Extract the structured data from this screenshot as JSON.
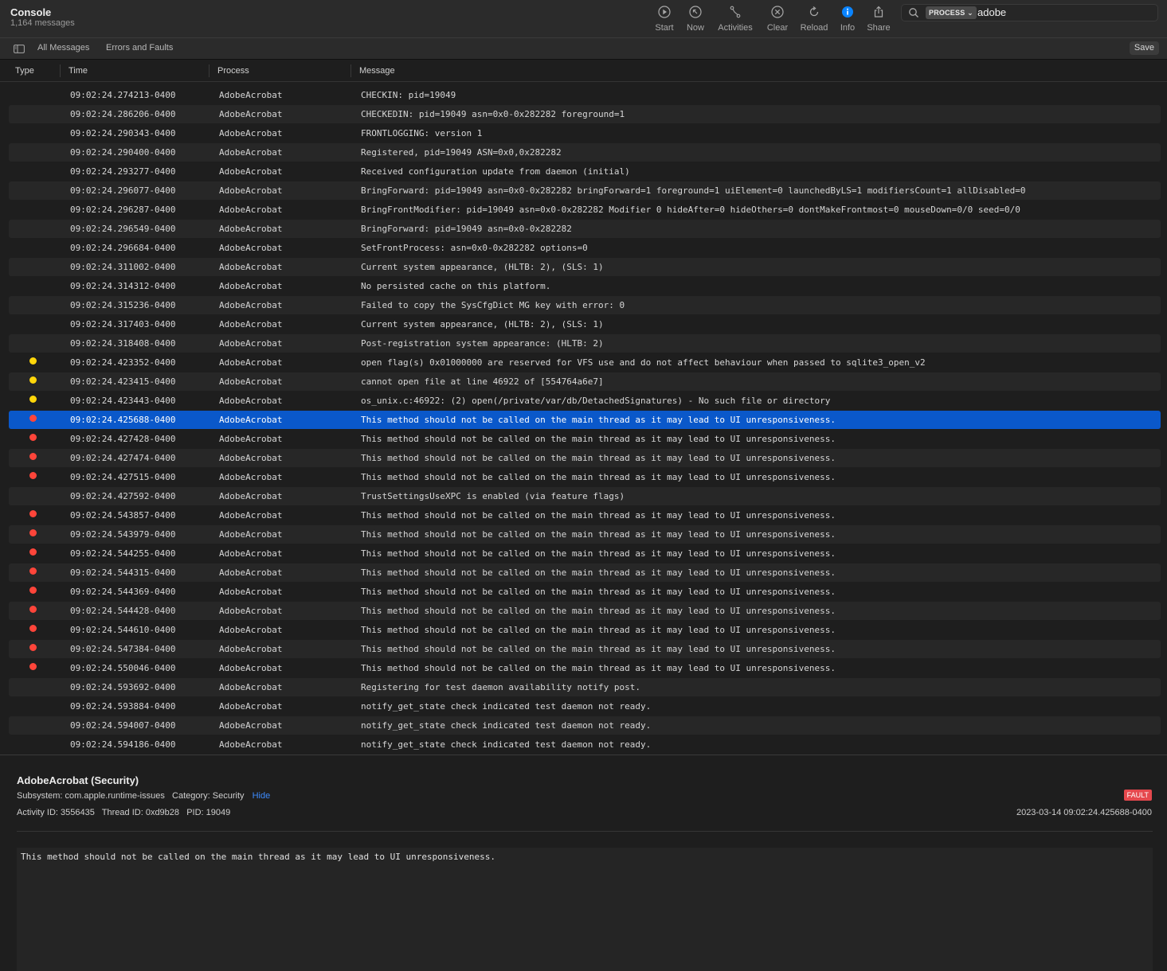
{
  "window": {
    "title": "Console",
    "subtitle": "1,164 messages"
  },
  "toolbar": {
    "start": "Start",
    "now": "Now",
    "activities": "Activities",
    "clear": "Clear",
    "reload": "Reload",
    "info": "Info",
    "share": "Share"
  },
  "search": {
    "token": "PROCESS",
    "query": "adobe"
  },
  "filters": {
    "all": "All Messages",
    "errors": "Errors and Faults",
    "save": "Save"
  },
  "columns": {
    "type": "Type",
    "time": "Time",
    "process": "Process",
    "message": "Message"
  },
  "colors": {
    "selection": "#0a58ca",
    "error": "#ff453a",
    "default_warn": "#ffd60a",
    "fault_badge": "#e5484d",
    "info_accent": "#0a84ff"
  },
  "rows": [
    {
      "type": "",
      "time": "09:02:24.274213-0400",
      "process": "AdobeAcrobat",
      "message": "CHECKIN: pid=19049"
    },
    {
      "type": "",
      "time": "09:02:24.286206-0400",
      "process": "AdobeAcrobat",
      "message": "CHECKEDIN: pid=19049 asn=0x0-0x282282 foreground=1"
    },
    {
      "type": "",
      "time": "09:02:24.290343-0400",
      "process": "AdobeAcrobat",
      "message": "FRONTLOGGING: version 1"
    },
    {
      "type": "",
      "time": "09:02:24.290400-0400",
      "process": "AdobeAcrobat",
      "message": "Registered, pid=19049 ASN=0x0,0x282282"
    },
    {
      "type": "",
      "time": "09:02:24.293277-0400",
      "process": "AdobeAcrobat",
      "message": "Received configuration update from daemon (initial)"
    },
    {
      "type": "",
      "time": "09:02:24.296077-0400",
      "process": "AdobeAcrobat",
      "message": "BringForward: pid=19049 asn=0x0-0x282282 bringForward=1 foreground=1 uiElement=0 launchedByLS=1 modifiersCount=1 allDisabled=0"
    },
    {
      "type": "",
      "time": "09:02:24.296287-0400",
      "process": "AdobeAcrobat",
      "message": "BringFrontModifier: pid=19049 asn=0x0-0x282282 Modifier 0 hideAfter=0 hideOthers=0 dontMakeFrontmost=0 mouseDown=0/0 seed=0/0"
    },
    {
      "type": "",
      "time": "09:02:24.296549-0400",
      "process": "AdobeAcrobat",
      "message": "BringForward: pid=19049 asn=0x0-0x282282"
    },
    {
      "type": "",
      "time": "09:02:24.296684-0400",
      "process": "AdobeAcrobat",
      "message": "SetFrontProcess: asn=0x0-0x282282 options=0"
    },
    {
      "type": "",
      "time": "09:02:24.311002-0400",
      "process": "AdobeAcrobat",
      "message": "Current system appearance, (HLTB: 2), (SLS: 1)"
    },
    {
      "type": "",
      "time": "09:02:24.314312-0400",
      "process": "AdobeAcrobat",
      "message": "No persisted cache on this platform."
    },
    {
      "type": "",
      "time": "09:02:24.315236-0400",
      "process": "AdobeAcrobat",
      "message": "Failed to copy the SysCfgDict MG key with error: 0"
    },
    {
      "type": "",
      "time": "09:02:24.317403-0400",
      "process": "AdobeAcrobat",
      "message": "Current system appearance, (HLTB: 2), (SLS: 1)"
    },
    {
      "type": "",
      "time": "09:02:24.318408-0400",
      "process": "AdobeAcrobat",
      "message": "Post-registration system appearance: (HLTB: 2)"
    },
    {
      "type": "warning",
      "time": "09:02:24.423352-0400",
      "process": "AdobeAcrobat",
      "message": "open flag(s) 0x01000000 are reserved for VFS use and do not affect behaviour when passed to sqlite3_open_v2"
    },
    {
      "type": "warning",
      "time": "09:02:24.423415-0400",
      "process": "AdobeAcrobat",
      "message": "cannot open file at line 46922 of [554764a6e7]"
    },
    {
      "type": "warning",
      "time": "09:02:24.423443-0400",
      "process": "AdobeAcrobat",
      "message": "os_unix.c:46922: (2) open(/private/var/db/DetachedSignatures) - No such file or directory"
    },
    {
      "type": "fault",
      "selected": true,
      "time": "09:02:24.425688-0400",
      "process": "AdobeAcrobat",
      "message": "This method should not be called on the main thread as it may lead to UI unresponsiveness."
    },
    {
      "type": "fault",
      "time": "09:02:24.427428-0400",
      "process": "AdobeAcrobat",
      "message": "This method should not be called on the main thread as it may lead to UI unresponsiveness."
    },
    {
      "type": "fault",
      "time": "09:02:24.427474-0400",
      "process": "AdobeAcrobat",
      "message": "This method should not be called on the main thread as it may lead to UI unresponsiveness."
    },
    {
      "type": "fault",
      "time": "09:02:24.427515-0400",
      "process": "AdobeAcrobat",
      "message": "This method should not be called on the main thread as it may lead to UI unresponsiveness."
    },
    {
      "type": "",
      "time": "09:02:24.427592-0400",
      "process": "AdobeAcrobat",
      "message": "TrustSettingsUseXPC is enabled (via feature flags)"
    },
    {
      "type": "fault",
      "time": "09:02:24.543857-0400",
      "process": "AdobeAcrobat",
      "message": "This method should not be called on the main thread as it may lead to UI unresponsiveness."
    },
    {
      "type": "fault",
      "time": "09:02:24.543979-0400",
      "process": "AdobeAcrobat",
      "message": "This method should not be called on the main thread as it may lead to UI unresponsiveness."
    },
    {
      "type": "fault",
      "time": "09:02:24.544255-0400",
      "process": "AdobeAcrobat",
      "message": "This method should not be called on the main thread as it may lead to UI unresponsiveness."
    },
    {
      "type": "fault",
      "time": "09:02:24.544315-0400",
      "process": "AdobeAcrobat",
      "message": "This method should not be called on the main thread as it may lead to UI unresponsiveness."
    },
    {
      "type": "fault",
      "time": "09:02:24.544369-0400",
      "process": "AdobeAcrobat",
      "message": "This method should not be called on the main thread as it may lead to UI unresponsiveness."
    },
    {
      "type": "fault",
      "time": "09:02:24.544428-0400",
      "process": "AdobeAcrobat",
      "message": "This method should not be called on the main thread as it may lead to UI unresponsiveness."
    },
    {
      "type": "fault",
      "time": "09:02:24.544610-0400",
      "process": "AdobeAcrobat",
      "message": "This method should not be called on the main thread as it may lead to UI unresponsiveness."
    },
    {
      "type": "fault",
      "time": "09:02:24.547384-0400",
      "process": "AdobeAcrobat",
      "message": "This method should not be called on the main thread as it may lead to UI unresponsiveness."
    },
    {
      "type": "fault",
      "time": "09:02:24.550046-0400",
      "process": "AdobeAcrobat",
      "message": "This method should not be called on the main thread as it may lead to UI unresponsiveness."
    },
    {
      "type": "",
      "time": "09:02:24.593692-0400",
      "process": "AdobeAcrobat",
      "message": "Registering for test daemon availability notify post."
    },
    {
      "type": "",
      "time": "09:02:24.593884-0400",
      "process": "AdobeAcrobat",
      "message": "notify_get_state check indicated test daemon not ready."
    },
    {
      "type": "",
      "time": "09:02:24.594007-0400",
      "process": "AdobeAcrobat",
      "message": "notify_get_state check indicated test daemon not ready."
    },
    {
      "type": "",
      "time": "09:02:24.594186-0400",
      "process": "AdobeAcrobat",
      "message": "notify_get_state check indicated test daemon not ready."
    }
  ],
  "detail": {
    "title": "AdobeAcrobat (Security)",
    "subsystem": "Subsystem: com.apple.runtime-issues",
    "category": "Category: Security",
    "hide": "Hide",
    "ids": "Activity ID: 3556435   Thread ID: 0xd9b28   PID: 19049",
    "badge": "FAULT",
    "timestamp": "2023-03-14 09:02:24.425688-0400",
    "message": "This method should not be called on the main thread as it may lead to UI unresponsiveness."
  }
}
